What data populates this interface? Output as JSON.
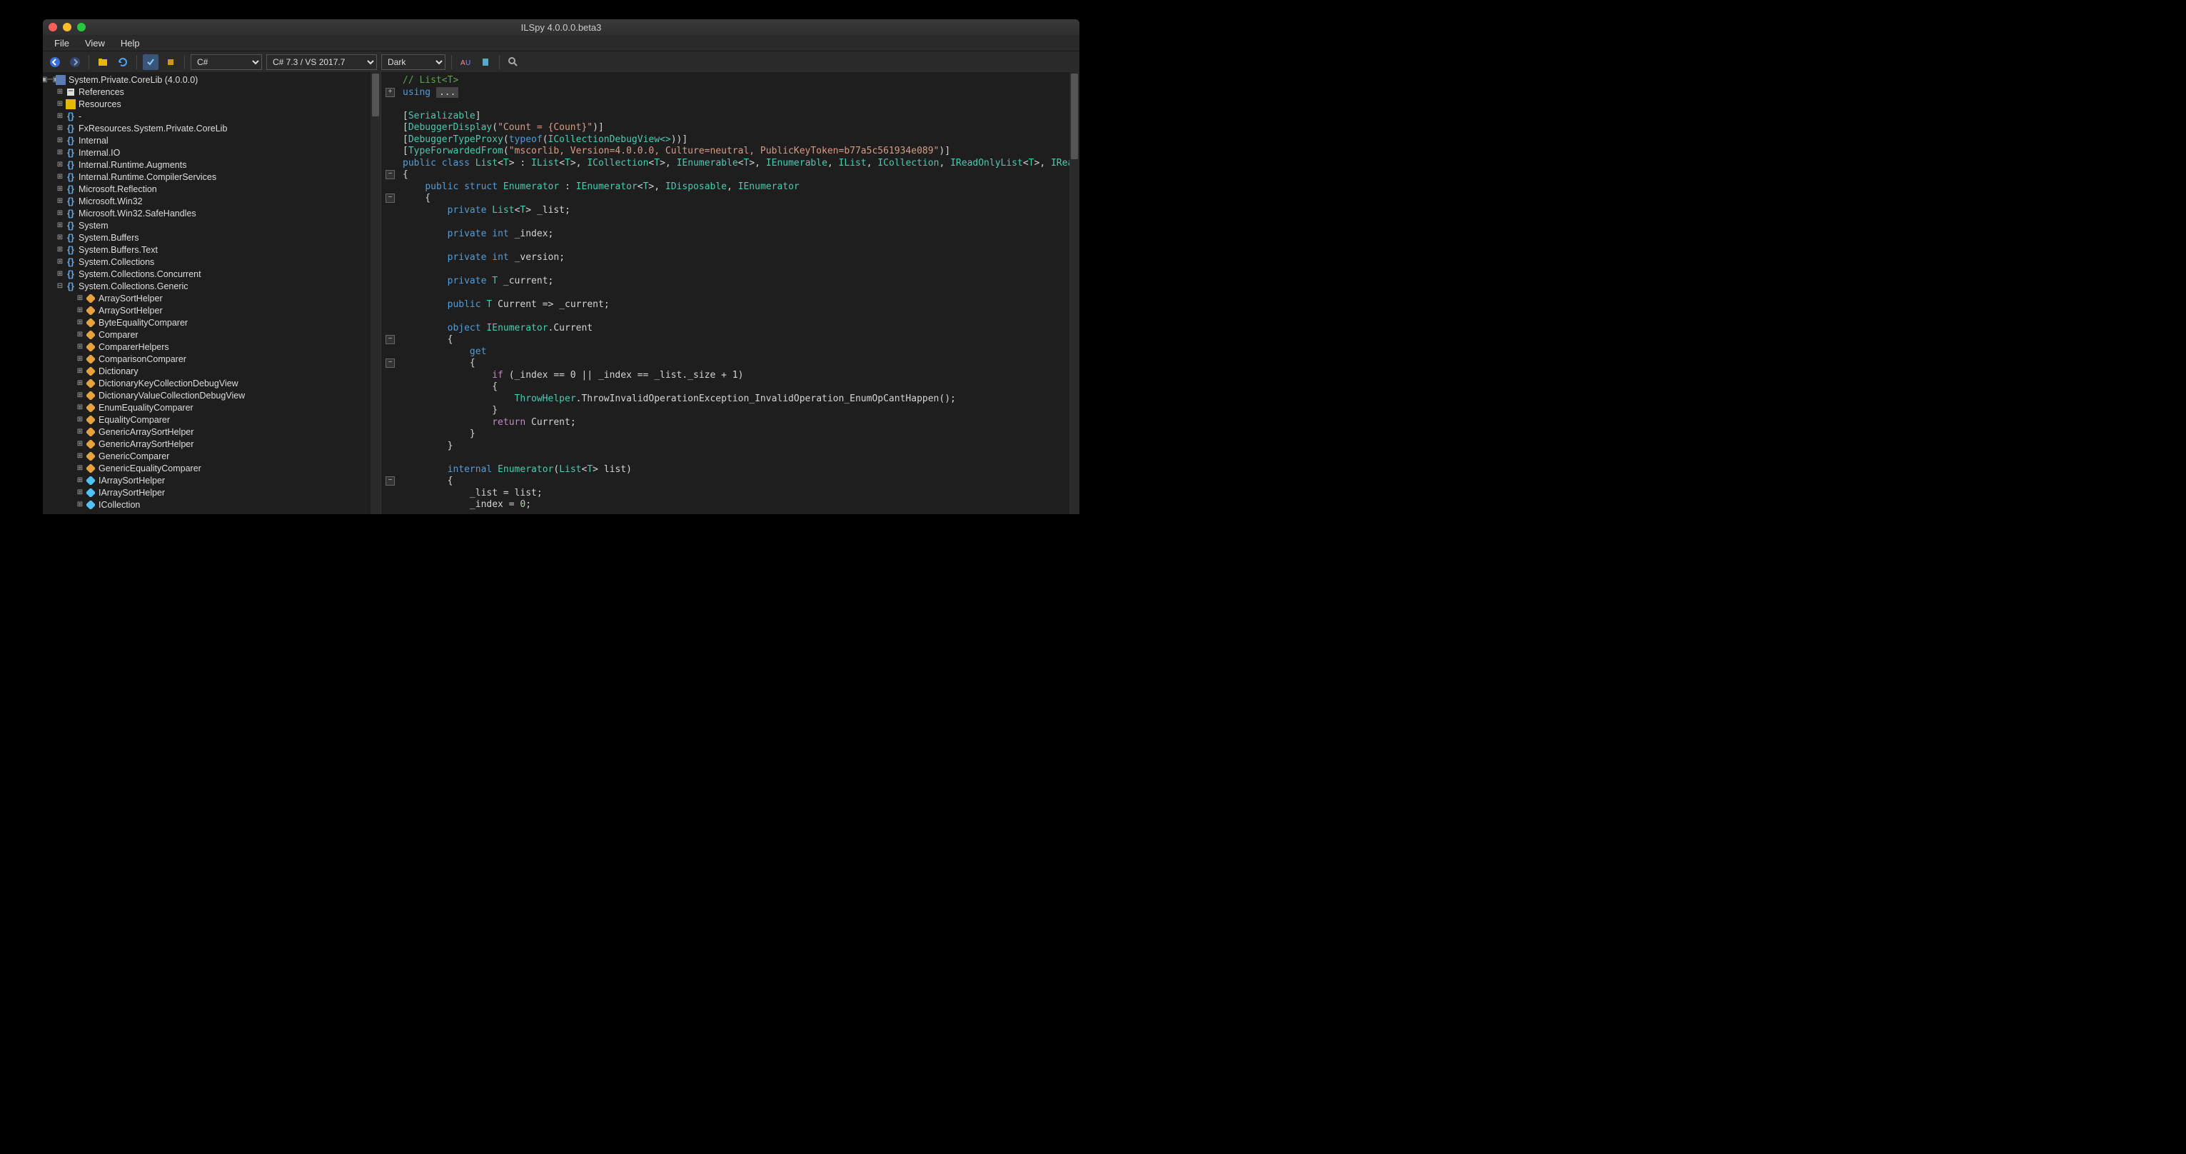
{
  "window": {
    "title": "ILSpy 4.0.0.0.beta3"
  },
  "menu": {
    "file": "File",
    "view": "View",
    "help": "Help"
  },
  "toolbar": {
    "language": "C#",
    "version": "C# 7.3 / VS 2017.7",
    "theme": "Dark"
  },
  "tree": {
    "root": "System.Private.CoreLib (4.0.0.0)",
    "references": "References",
    "resources": "Resources",
    "dash": "-",
    "items": [
      "FxResources.System.Private.CoreLib",
      "Internal",
      "Internal.IO",
      "Internal.Runtime.Augments",
      "Internal.Runtime.CompilerServices",
      "Microsoft.Reflection",
      "Microsoft.Win32",
      "Microsoft.Win32.SafeHandles",
      "System",
      "System.Buffers",
      "System.Buffers.Text",
      "System.Collections",
      "System.Collections.Concurrent",
      "System.Collections.Generic"
    ],
    "generic": [
      {
        "name": "ArraySortHelper<T>",
        "kind": "cls"
      },
      {
        "name": "ArraySortHelper<TKey,TValue>",
        "kind": "cls"
      },
      {
        "name": "ByteEqualityComparer",
        "kind": "cls"
      },
      {
        "name": "Comparer<T>",
        "kind": "cls"
      },
      {
        "name": "ComparerHelpers",
        "kind": "cls"
      },
      {
        "name": "ComparisonComparer<T>",
        "kind": "cls"
      },
      {
        "name": "Dictionary<TKey,TValue>",
        "kind": "cls"
      },
      {
        "name": "DictionaryKeyCollectionDebugView<TKey,TValue>",
        "kind": "cls"
      },
      {
        "name": "DictionaryValueCollectionDebugView<TKey,TValue>",
        "kind": "cls"
      },
      {
        "name": "EnumEqualityComparer<T>",
        "kind": "cls"
      },
      {
        "name": "EqualityComparer<T>",
        "kind": "cls"
      },
      {
        "name": "GenericArraySortHelper<T>",
        "kind": "cls"
      },
      {
        "name": "GenericArraySortHelper<TKey,TValue>",
        "kind": "cls"
      },
      {
        "name": "GenericComparer<T>",
        "kind": "cls"
      },
      {
        "name": "GenericEqualityComparer<T>",
        "kind": "cls"
      },
      {
        "name": "IArraySortHelper<TKey>",
        "kind": "int"
      },
      {
        "name": "IArraySortHelper<TKey,TValue>",
        "kind": "int"
      },
      {
        "name": "ICollection<T>",
        "kind": "int"
      }
    ]
  },
  "code": {
    "comment": "// List<T>",
    "using": "using",
    "attrs": {
      "serializable": "Serializable",
      "dbgdisplay": "DebuggerDisplay",
      "dbgdisplay_arg": "\"Count = {Count}\"",
      "dbgproxy": "DebuggerTypeProxy",
      "typeof": "typeof",
      "proxy_t": "ICollectionDebugView<>",
      "tfwd": "TypeForwardedFrom",
      "tfwd_arg": "\"mscorlib, Version=4.0.0.0, Culture=neutral, PublicKeyToken=b77a5c561934e089\""
    },
    "cls": {
      "public": "public",
      "class": "class",
      "name": "List",
      "T": "T",
      "ilist": "IList",
      "icol": "ICollection",
      "ienum": "IEnumerable",
      "ienum0": "IEnumerable",
      "ilist0": "IList",
      "icol0": "ICollection",
      "irol": "IReadOnlyList",
      "iroc": "IReadOnlyCollection"
    },
    "enum": {
      "struct": "struct",
      "name": "Enumerator",
      "ienumT": "IEnumerator",
      "idisp": "IDisposable",
      "ienum0": "IEnumerator",
      "private": "private",
      "int": "int",
      "object": "object",
      "get": "get",
      "return": "return",
      "if": "if",
      "internal": "internal",
      "list_f": "_list",
      "index_f": "_index",
      "version_f": "_version",
      "current_f": "_current",
      "T": "T",
      "Current": "Current",
      "current_expr": "_current",
      "throw_t": "ThrowHelper",
      "throw_m": "ThrowInvalidOperationException_InvalidOperation_EnumOpCantHappen",
      "cond": "(_index == 0 || _index == _list._size + 1)",
      "list_p": "list",
      "assign1": "_list = list;",
      "assign2_l": "_index = ",
      "zero": "0"
    }
  }
}
